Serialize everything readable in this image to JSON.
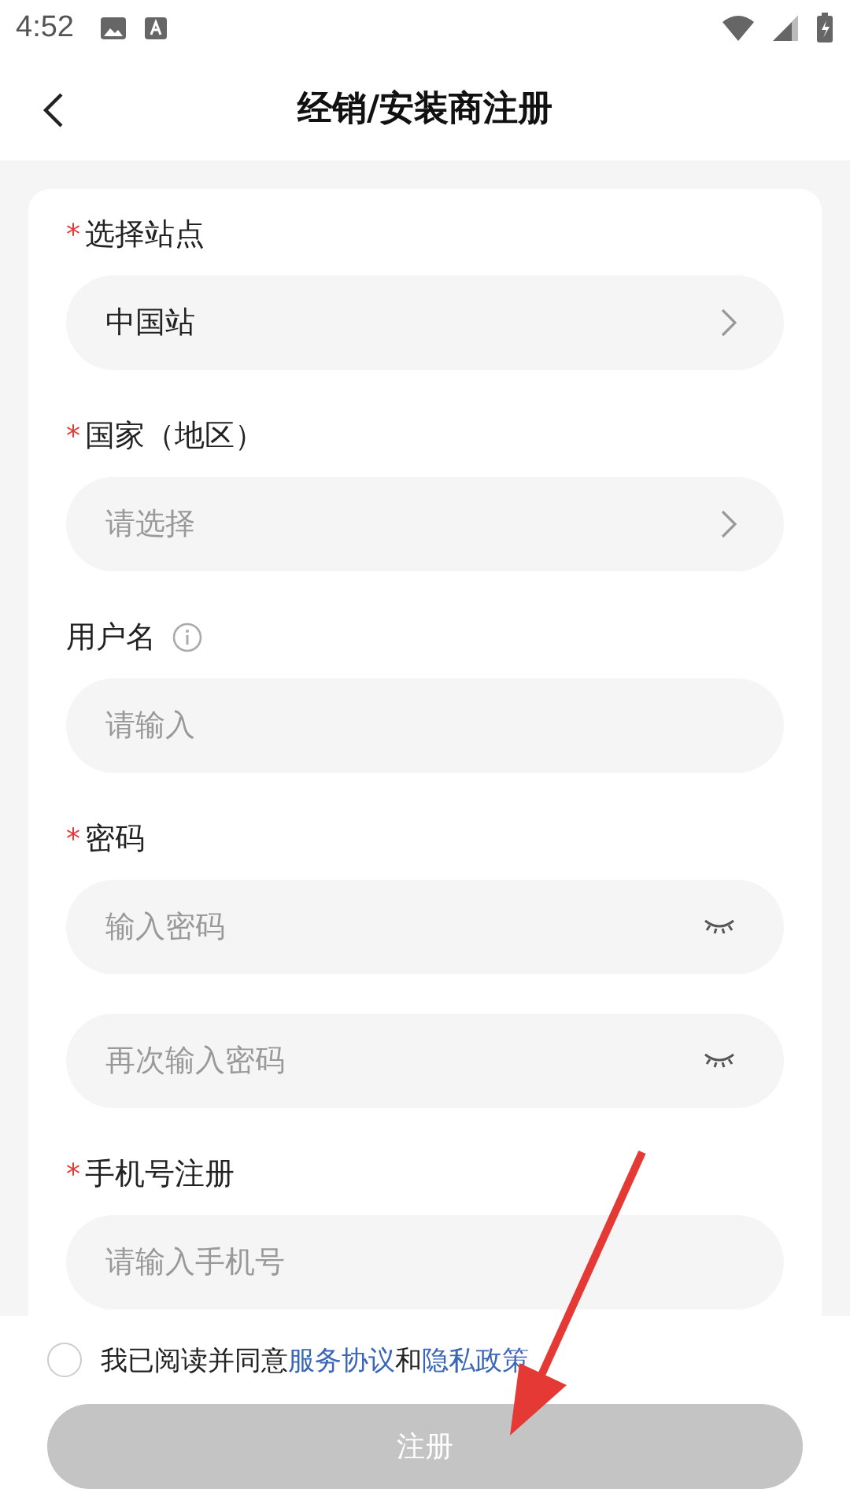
{
  "status_bar": {
    "time": "4:52"
  },
  "header": {
    "title": "经销/安装商注册"
  },
  "form": [
    {
      "mark": "*",
      "label": "选择站点",
      "fields": [
        {
          "kind": "select",
          "value": "中国站"
        }
      ]
    },
    {
      "mark": "*",
      "label": "国家（地区）",
      "fields": [
        {
          "kind": "select",
          "placeholder": "请选择"
        }
      ]
    },
    {
      "label": "用户名",
      "info": true,
      "fields": [
        {
          "kind": "text",
          "placeholder": "请输入"
        }
      ]
    },
    {
      "mark": "*",
      "label": "密码",
      "fields": [
        {
          "kind": "password",
          "placeholder": "输入密码"
        },
        {
          "kind": "password",
          "placeholder": "再次输入密码"
        }
      ]
    },
    {
      "mark": "*",
      "label": "手机号注册",
      "fields": [
        {
          "kind": "text",
          "placeholder": "请输入手机号"
        }
      ]
    }
  ],
  "agreement": {
    "checked": false,
    "text": "我已阅读并同意",
    "link1": "服务协议",
    "joiner": "和",
    "link2": "隐私政策"
  },
  "submit": {
    "label": "注册",
    "disabled": true
  }
}
